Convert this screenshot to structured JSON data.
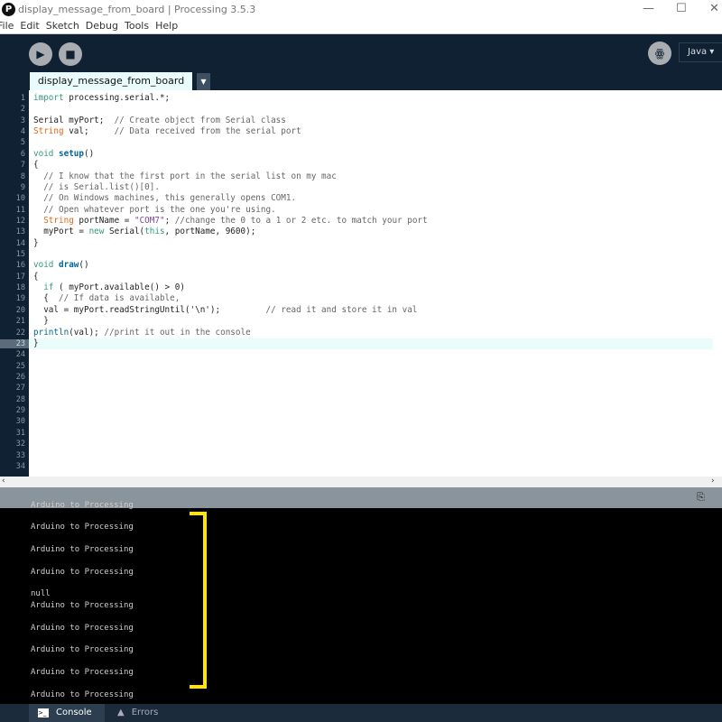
{
  "window": {
    "title": "display_message_from_board | Processing 3.5.3",
    "logo": "P",
    "minimize": "—",
    "maximize": "☐",
    "close": "✕"
  },
  "menu": [
    "File",
    "Edit",
    "Sketch",
    "Debug",
    "Tools",
    "Help"
  ],
  "toolbar": {
    "run_icon": "▶",
    "stop_icon": "■",
    "debugger_icon": "ꙮ",
    "mode": "Java ▾"
  },
  "tab": {
    "name": "display_message_from_board",
    "menu_arrow": "▼"
  },
  "editor": {
    "current_line": 23,
    "line_count": 34,
    "lines": [
      "import processing.serial.*;",
      "",
      "Serial myPort;  // Create object from Serial class",
      "String val;     // Data received from the serial port",
      "",
      "void setup()",
      "{",
      "  // I know that the first port in the serial list on my mac",
      "  // is Serial.list()[0].",
      "  // On Windows machines, this generally opens COM1.",
      "  // Open whatever port is the one you're using.",
      "  String portName = \"COM7\"; //change the 0 to a 1 or 2 etc. to match your port",
      "  myPort = new Serial(this, portName, 9600);",
      "}",
      "",
      "void draw()",
      "{",
      "  if ( myPort.available() > 0)",
      "  {  // If data is available,",
      "  val = myPort.readStringUntil('\\n');         // read it and store it in val",
      "  }",
      "println(val); //print it out in the console",
      "}"
    ]
  },
  "console": {
    "lines": [
      "Arduino to Processing",
      "",
      "Arduino to Processing",
      "",
      "Arduino to Processing",
      "",
      "null",
      "Arduino to Processing",
      "",
      "Arduino to Processing",
      "",
      "Arduino to Processing",
      "",
      "Arduino to Processing",
      "",
      "Arduino to Processing"
    ],
    "highlight_color": "#ffe600"
  },
  "bottom_tabs": [
    {
      "label": "Console",
      "icon": "console-icon"
    },
    {
      "label": "Errors",
      "icon": "warning-icon"
    }
  ],
  "colors": {
    "toolbar": "#0f2133",
    "keyword": "#33997e",
    "type": "#e2661a",
    "function": "#006699",
    "comment": "#666666",
    "string": "#7d4793"
  }
}
